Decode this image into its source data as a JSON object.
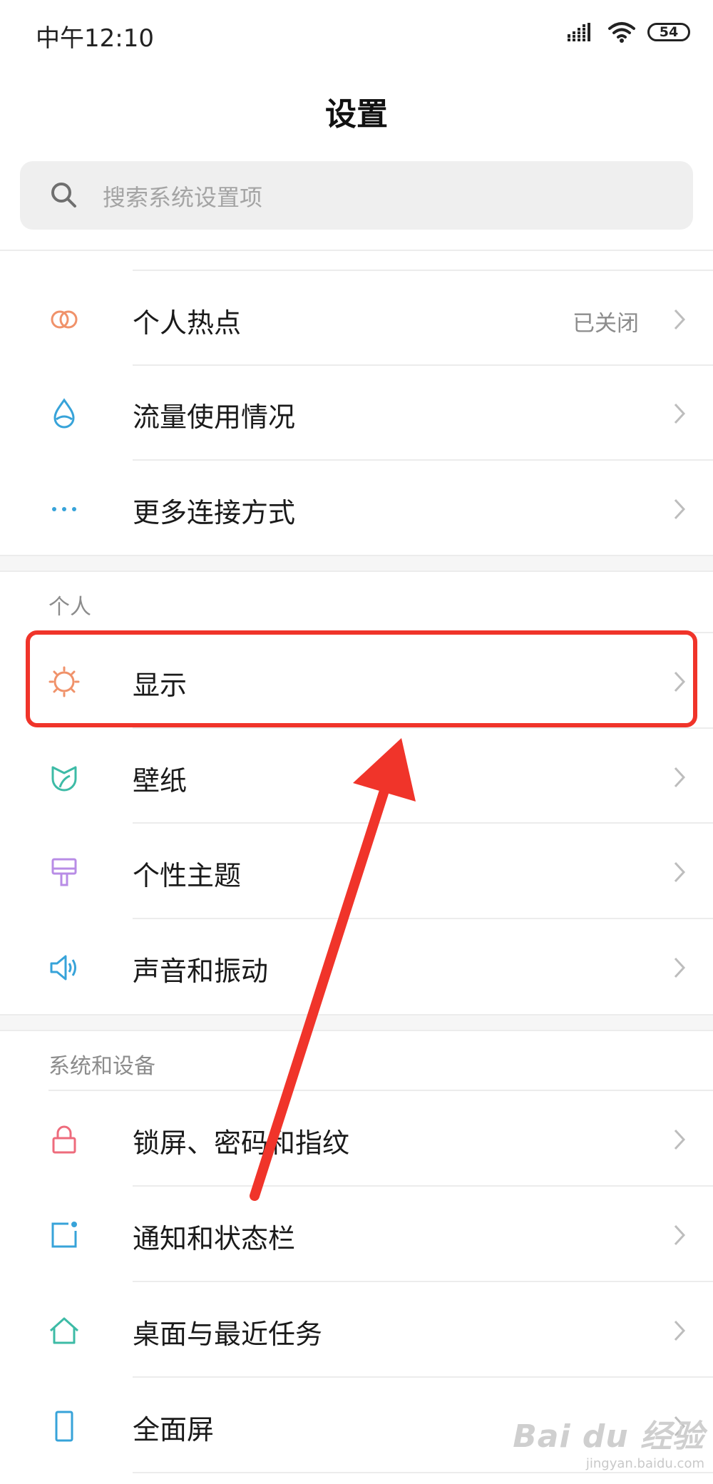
{
  "status_bar": {
    "time": "中午12:10",
    "battery": "54",
    "icons": [
      "signal-icon",
      "wifi-icon",
      "battery-icon"
    ]
  },
  "header": {
    "title": "设置"
  },
  "search": {
    "placeholder": "搜索系统设置项"
  },
  "connection_rows": [
    {
      "label": "个人热点",
      "value": "已关闭",
      "icon": "hotspot-icon",
      "color": "#f0926a"
    },
    {
      "label": "流量使用情况",
      "icon": "data-usage-icon",
      "color": "#37a3d9"
    },
    {
      "label": "更多连接方式",
      "icon": "more-dots-icon",
      "color": "#37a3d9"
    }
  ],
  "sections": [
    {
      "header": "个人",
      "items": [
        {
          "label": "显示",
          "icon": "display-sun-icon",
          "color": "#f0926a"
        },
        {
          "label": "壁纸",
          "icon": "wallpaper-icon",
          "color": "#3dbba6"
        },
        {
          "label": "个性主题",
          "icon": "theme-brush-icon",
          "color": "#b88ce6"
        },
        {
          "label": "声音和振动",
          "icon": "sound-icon",
          "color": "#37a3d9"
        }
      ]
    },
    {
      "header": "系统和设备",
      "items": [
        {
          "label": "锁屏、密码和指纹",
          "icon": "lock-icon",
          "color": "#ee6b7c"
        },
        {
          "label": "通知和状态栏",
          "icon": "notification-icon",
          "color": "#37a3d9"
        },
        {
          "label": "桌面与最近任务",
          "icon": "home-icon",
          "color": "#3dbba6"
        },
        {
          "label": "全面屏",
          "icon": "fullscreen-phone-icon",
          "color": "#37a3d9"
        }
      ]
    }
  ],
  "annotation": {
    "color": "#f0342a"
  },
  "watermark": {
    "logo": "Bai du 经验",
    "url": "jingyan.baidu.com"
  }
}
